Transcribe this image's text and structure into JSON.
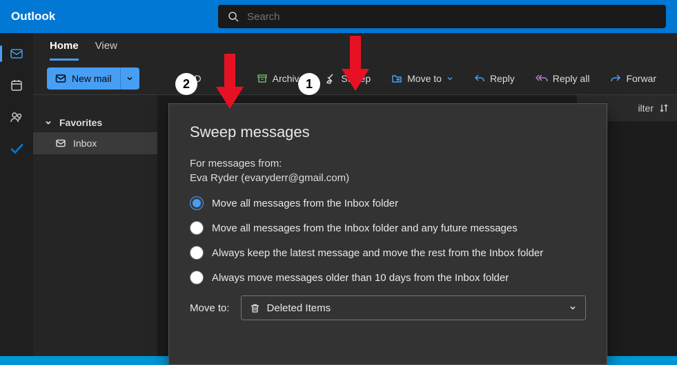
{
  "app": {
    "title": "Outlook"
  },
  "search": {
    "placeholder": "Search"
  },
  "tabs": {
    "home": "Home",
    "view": "View"
  },
  "toolbar": {
    "new_mail": "New mail",
    "delete_partial": "D",
    "archive": "Archive",
    "sweep": "Sweep",
    "move_to": "Move to",
    "reply": "Reply",
    "reply_all": "Reply all",
    "forward": "Forwar"
  },
  "nav": {
    "favorites": "Favorites",
    "inbox": "Inbox"
  },
  "right": {
    "filter": "ilter"
  },
  "dialog": {
    "title": "Sweep messages",
    "subtitle": "For messages from:",
    "sender": "Eva Ryder (evaryderr@gmail.com)",
    "options": [
      "Move all messages from the Inbox folder",
      "Move all messages from the Inbox folder and any future messages",
      "Always keep the latest message and move the rest from the Inbox folder",
      "Always move messages older than 10 days from the Inbox folder"
    ],
    "selected_index": 0,
    "move_label": "Move to:",
    "move_target": "Deleted Items"
  },
  "annotations": {
    "badge1": "1",
    "badge2": "2"
  }
}
